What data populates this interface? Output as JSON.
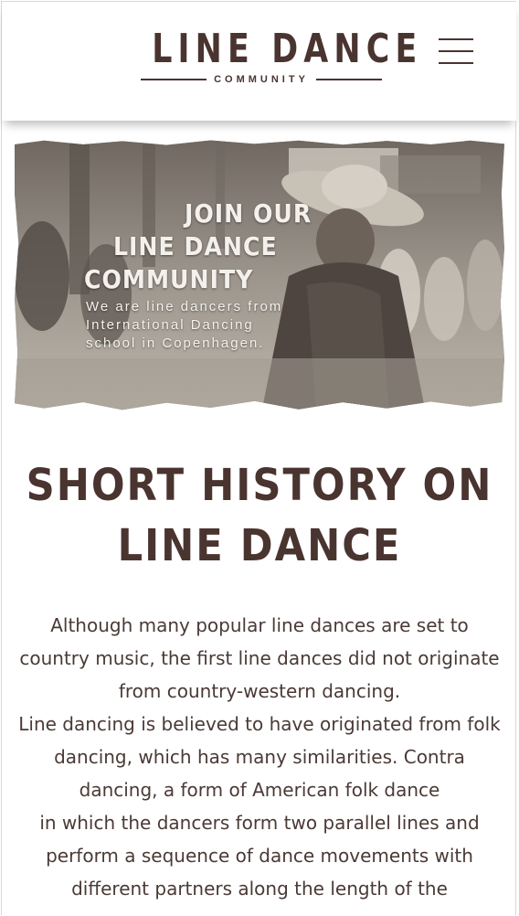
{
  "header": {
    "logo_title": "LINE DANCE",
    "logo_subtitle": "COMMUNITY",
    "menu_icon": "hamburger-menu-icon"
  },
  "hero": {
    "title_line1": "JOIN OUR",
    "title_line2": "LINE DANCE",
    "title_line3": "COMMUNITY",
    "description": "We are line dancers from International Dancing school in Copenhagen."
  },
  "main": {
    "section_title": "SHORT HISTORY ON LINE DANCE",
    "body": "Although many popular line dances are set to country music, the first line dances did not originate from country-western dancing.\nLine dancing is believed to have originated from folk dancing, which has many similarities. Contra dancing, a form of American folk dance\nin which the dancers form two parallel lines and perform a sequence of dance movements with different partners along the length of the"
  },
  "colors": {
    "brand_brown": "#4a3430",
    "text_brown": "#4a3a36",
    "background": "#ffffff"
  }
}
